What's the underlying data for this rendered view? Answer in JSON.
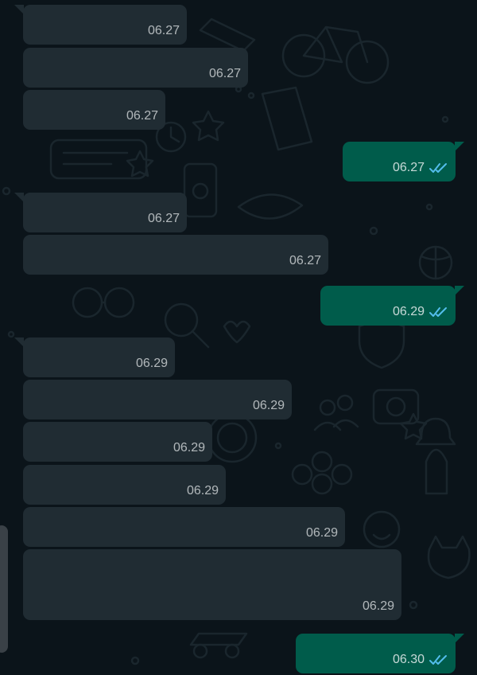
{
  "colors": {
    "background": "#0b141a",
    "incoming_bubble": "#202c33",
    "outgoing_bubble": "#005c4b",
    "read_ticks": "#53bdeb"
  },
  "messages": [
    {
      "direction": "incoming",
      "time": "06.27"
    },
    {
      "direction": "incoming",
      "time": "06.27"
    },
    {
      "direction": "incoming",
      "time": "06.27"
    },
    {
      "direction": "outgoing",
      "time": "06.27",
      "status": "read",
      "status_icon": "double-check-icon"
    },
    {
      "direction": "incoming",
      "time": "06.27"
    },
    {
      "direction": "incoming",
      "time": "06.27"
    },
    {
      "direction": "outgoing",
      "time": "06.29",
      "status": "read",
      "status_icon": "double-check-icon"
    },
    {
      "direction": "incoming",
      "time": "06.29"
    },
    {
      "direction": "incoming",
      "time": "06.29"
    },
    {
      "direction": "incoming",
      "time": "06.29"
    },
    {
      "direction": "incoming",
      "time": "06.29"
    },
    {
      "direction": "incoming",
      "time": "06.29"
    },
    {
      "direction": "incoming",
      "time": "06.29"
    },
    {
      "direction": "outgoing",
      "time": "06.30",
      "status": "read",
      "status_icon": "double-check-icon"
    }
  ]
}
